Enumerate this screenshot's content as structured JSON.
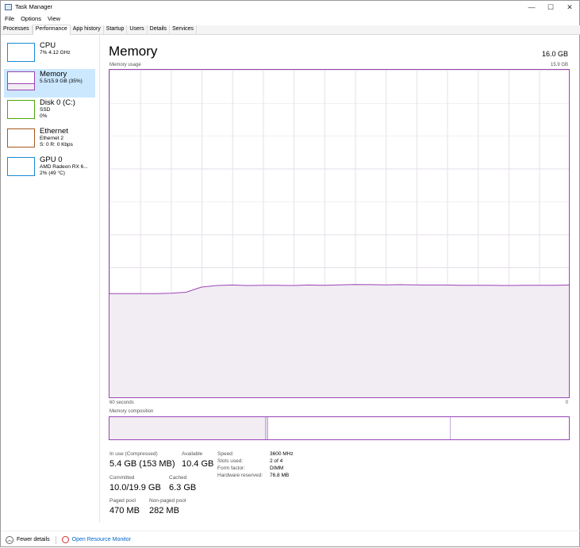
{
  "window": {
    "title": "Task Manager",
    "controls": [
      "—",
      "☐",
      "✕"
    ]
  },
  "menu": [
    "File",
    "Options",
    "View"
  ],
  "tabs": [
    "Processes",
    "Performance",
    "App history",
    "Startup",
    "Users",
    "Details",
    "Services"
  ],
  "sidebar": [
    {
      "name": "CPU",
      "sub1": "7% 4.12 GHz",
      "sub2": "",
      "color": "#1a8ad6"
    },
    {
      "name": "Memory",
      "sub1": "5.5/15.9 GB (35%)",
      "sub2": "",
      "color": "#9b44b5"
    },
    {
      "name": "Disk 0 (C:)",
      "sub1": "SSD",
      "sub2": "0%",
      "color": "#4da60c"
    },
    {
      "name": "Ethernet",
      "sub1": "Ethernet 2",
      "sub2": "S: 0 R: 0 Kbps",
      "color": "#a7571d"
    },
    {
      "name": "GPU 0",
      "sub1": "AMD Radeon RX 6...",
      "sub2": "2% (49 °C)",
      "color": "#1a8ad6"
    }
  ],
  "main": {
    "title": "Memory",
    "total": "16.0 GB",
    "usage_label": "Memory usage",
    "usage_max": "15.9 GB",
    "x_left": "60 seconds",
    "x_right": "0",
    "composition_label": "Memory composition",
    "usage_series_gb": [
      5.03,
      5.03,
      5.03,
      5.03,
      5.05,
      5.1,
      5.35,
      5.43,
      5.45,
      5.43,
      5.44,
      5.44,
      5.43,
      5.45,
      5.44,
      5.46,
      5.48,
      5.47,
      5.46,
      5.47,
      5.46,
      5.45,
      5.45,
      5.44,
      5.44,
      5.44,
      5.43,
      5.44,
      5.44,
      5.44,
      5.45
    ],
    "composition": {
      "in_use_gb": 5.4,
      "modified_gb": 0.1,
      "standby_gb": 6.3,
      "free_gb": 4.1,
      "total_gb": 15.9
    },
    "stats": [
      {
        "label": "In use (Compressed)",
        "value": "5.4 GB (153 MB)"
      },
      {
        "label": "Available",
        "value": "10.4 GB"
      },
      {
        "label": "Committed",
        "value": "10.0/19.9 GB"
      },
      {
        "label": "Cached",
        "value": "6.3 GB"
      },
      {
        "label": "Paged pool",
        "value": "470 MB"
      },
      {
        "label": "Non-paged pool",
        "value": "282 MB"
      }
    ],
    "details": [
      {
        "k": "Speed:",
        "v": "3600 MHz"
      },
      {
        "k": "Slots used:",
        "v": "2 of 4"
      },
      {
        "k": "Form factor:",
        "v": "DIMM"
      },
      {
        "k": "Hardware reserved:",
        "v": "76.8 MB"
      }
    ]
  },
  "footer": {
    "fewer": "Fewer details",
    "monitor": "Open Resource Monitor"
  },
  "colors": {
    "accent": "#9b44b5",
    "fill": "#f1edf3",
    "link": "#0066cc"
  }
}
